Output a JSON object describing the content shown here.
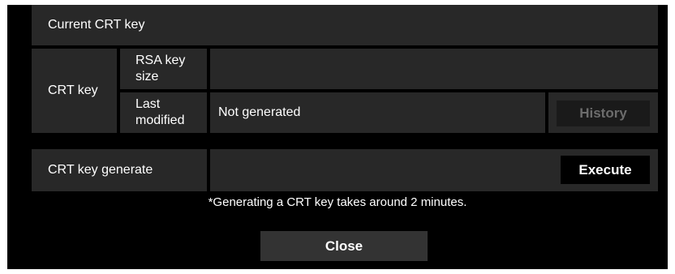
{
  "section": {
    "title": "Current CRT key",
    "row_label": "CRT key",
    "rsa_label_1": "RSA key",
    "rsa_label_2": "size",
    "rsa_value": "",
    "modified_label_1": "Last",
    "modified_label_2": "modified",
    "modified_value": "Not generated",
    "history_button": "History"
  },
  "generate": {
    "label": "CRT key generate",
    "execute_button": "Execute"
  },
  "note": "*Generating a CRT key takes around 2 minutes.",
  "close_button": "Close"
}
